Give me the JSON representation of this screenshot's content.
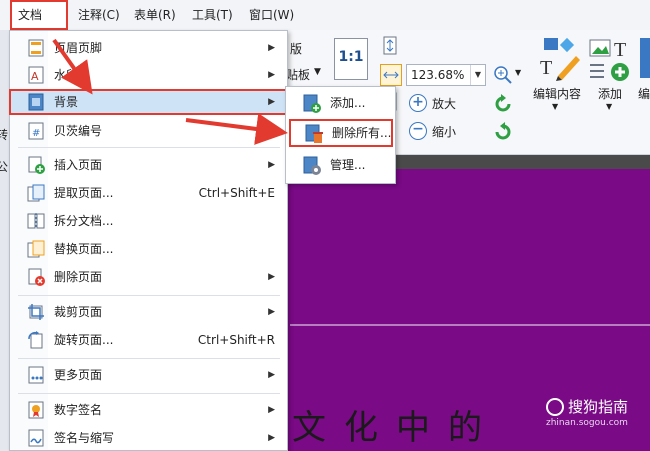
{
  "menubar": {
    "items": [
      {
        "label": "文档(D)"
      },
      {
        "label": "注释(C)"
      },
      {
        "label": "表单(R)"
      },
      {
        "label": "工具(T)"
      },
      {
        "label": "窗口(W)"
      }
    ]
  },
  "toolbar": {
    "zoom_value": "123.68%",
    "zoom_in_label": "放大",
    "zoom_out_label": "缩小",
    "partial_label_1": "版",
    "partial_label_2": "贴板",
    "edit_content_label": "编辑内容",
    "add_label": "添加",
    "edit_partial_label": "编",
    "actual_size_glyph": "1:1"
  },
  "menu": {
    "items": [
      {
        "label": "页眉页脚"
      },
      {
        "label": "水印"
      },
      {
        "label": "背景"
      },
      {
        "label": "贝茨编号"
      },
      {
        "label": "插入页面"
      },
      {
        "label": "提取页面...",
        "shortcut": "Ctrl+Shift+E"
      },
      {
        "label": "拆分文档..."
      },
      {
        "label": "替换页面..."
      },
      {
        "label": "删除页面"
      },
      {
        "label": "裁剪页面"
      },
      {
        "label": "旋转页面...",
        "shortcut": "Ctrl+Shift+R"
      },
      {
        "label": "更多页面"
      },
      {
        "label": "数字签名"
      },
      {
        "label": "签名与缩写"
      }
    ]
  },
  "submenu": {
    "items": [
      {
        "label": "添加..."
      },
      {
        "label": "删除所有..."
      },
      {
        "label": "管理..."
      }
    ]
  },
  "sidebar": {
    "partial_1": "转",
    "partial_2": "公"
  },
  "document": {
    "text": "文化中的"
  },
  "watermark": {
    "brand": "搜狗指南",
    "url": "zhinan.sogou.com"
  },
  "colors": {
    "highlight_border": "#e23a2e",
    "doc_background": "#7a0a86",
    "menu_hover": "#cfe3f7",
    "accent_blue": "#3b78c4"
  }
}
